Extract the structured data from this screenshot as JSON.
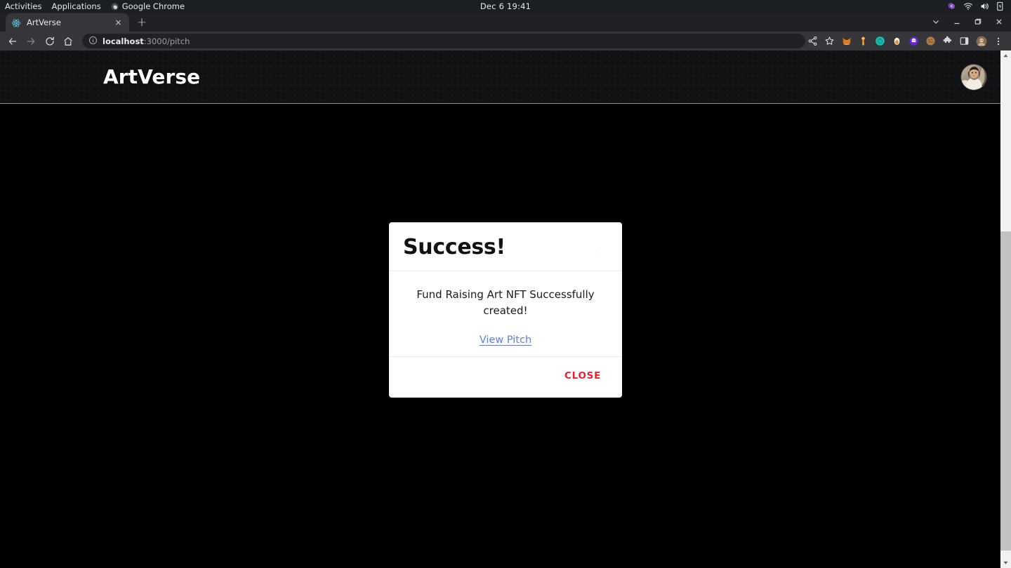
{
  "os_bar": {
    "activities": "Activities",
    "applications": "Applications",
    "app_name": "Google Chrome",
    "clock": "Dec 6  19:41",
    "tray_icons": [
      "app-indicator-icon",
      "wifi-icon",
      "volume-icon",
      "battery-icon"
    ]
  },
  "browser": {
    "tab": {
      "title": "ArtVerse",
      "favicon": "react-logo-icon",
      "close_label": "×"
    },
    "new_tab_label": "+",
    "window_controls": {
      "expand": "chevron-down-icon",
      "minimize": "minimize-icon",
      "maximize": "maximize-icon",
      "close": "close-icon"
    },
    "nav": {
      "back": "back-arrow-icon",
      "forward": "forward-arrow-icon",
      "reload": "reload-icon",
      "home": "home-icon"
    },
    "omnibox": {
      "info_icon": "page-info-icon",
      "url_host": "localhost",
      "url_path": ":3000/pitch"
    },
    "toolbar_icons": [
      "share-icon",
      "bookmark-star-icon",
      "metamask-fox-icon",
      "keplr-wallet-icon",
      "teal-circle-extension-icon",
      "phantom-egg-icon",
      "purple-ghost-extension-icon",
      "cookie-extension-icon",
      "extensions-puzzle-icon",
      "sidepanel-icon",
      "profile-avatar-icon",
      "chrome-menu-icon"
    ]
  },
  "site": {
    "brand": "ArtVerse",
    "avatar": "user-avatar-photo"
  },
  "dialog": {
    "title": "Success!",
    "message": "Fund Raising Art NFT Successfully created!",
    "link_label": "View Pitch",
    "close_label": "CLOSE",
    "close_color": "#f01b2c",
    "link_color": "#5b7ee8"
  },
  "scrollbar": {
    "up_arrow": "scroll-up-arrow-icon",
    "down_arrow": "scroll-down-arrow-icon"
  }
}
